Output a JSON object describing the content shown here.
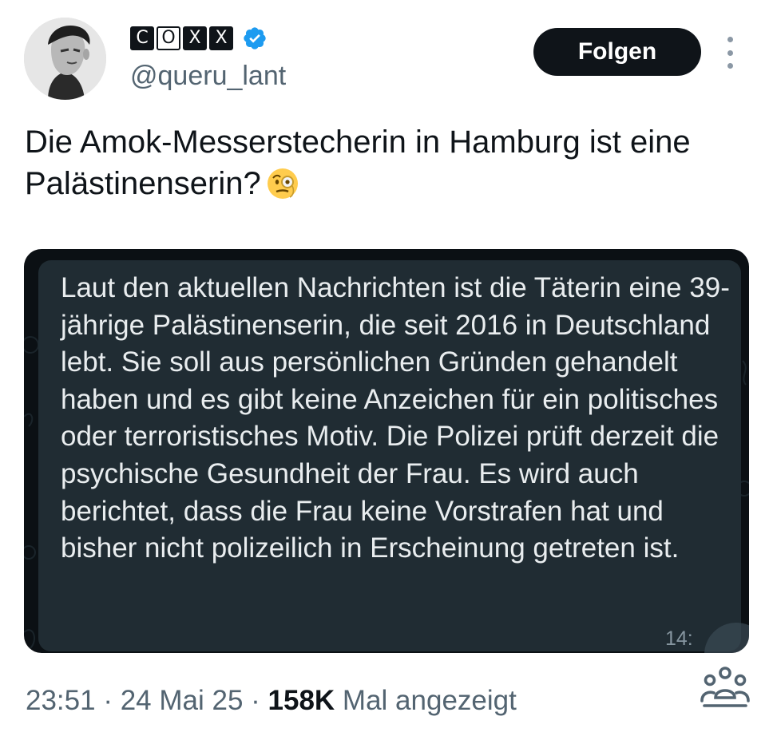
{
  "author": {
    "name_chars": [
      "C",
      "O",
      "X",
      "X"
    ],
    "handle": "@queru_lant",
    "verified_icon": "verified-badge-icon",
    "avatar_icon": "avatar"
  },
  "actions": {
    "follow_label": "Folgen",
    "more_icon": "more-vertical-icon"
  },
  "tweet": {
    "text": "Die Amok-Messerstecherin in Hamburg ist eine Palästinenserin?",
    "emoji": "face-with-monocle-emoji"
  },
  "media": {
    "message_text": "Laut den aktuellen Nachrichten ist die Täterin eine 39-jährige Palästinenserin, die seit 2016 in Deutschland lebt. Sie soll aus persönlichen Gründen gehandelt haben und es gibt keine Anzeichen für ein politisches oder terroristisches Motiv. Die Polizei prüft derzeit die psychische Gesundheit der Frau. Es wird auch berichtet, dass die Frau keine Vorstrafen hat und bisher nicht polizeilich in Erscheinung getreten ist.",
    "time": "14:"
  },
  "meta": {
    "time": "23:51",
    "separator": " · ",
    "date": "24 Mai 25",
    "views_count": "158K",
    "views_label": " Mal angezeigt",
    "community_icon": "community-icon"
  },
  "colors": {
    "accent_verified": "#1d9bf0",
    "button_bg": "#0f1419",
    "secondary_text": "#536471",
    "bubble_bg": "#202c33"
  }
}
